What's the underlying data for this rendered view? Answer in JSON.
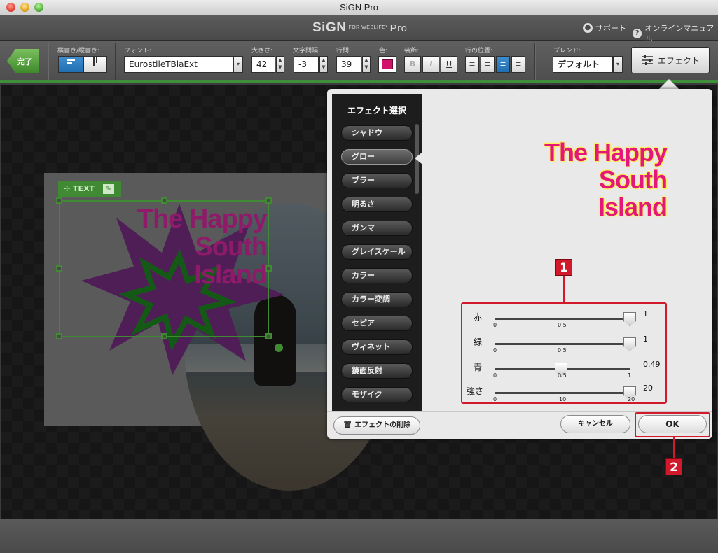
{
  "window": {
    "title": "SiGN Pro"
  },
  "app": {
    "logo_main": "SiGN",
    "logo_sub": "FOR WEBLIFE*",
    "logo_pro": "Pro",
    "support_label": "サポート",
    "manual_label": "オンラインマニュアル"
  },
  "toolbar": {
    "done_label": "完了",
    "orientation_label": "横書き/縦書き:",
    "font_label": "フォント:",
    "font_value": "EurostileTBlaExt",
    "size_label": "大きさ:",
    "size_value": "42",
    "spacing_label": "文字間隔:",
    "spacing_value": "-3",
    "line_label": "行間:",
    "line_value": "39",
    "color_label": "色:",
    "color_value": "#d0106a",
    "decoration_label": "装飾:",
    "deco_bold": "B",
    "deco_italic": "I",
    "deco_underline": "U",
    "align_label": "行の位置:",
    "blend_label": "ブレンド:",
    "blend_value": "デフォルト",
    "effect_button_label": "エフェクト"
  },
  "canvas": {
    "text_tag_label": "TEXT",
    "title_line1": "The Happy",
    "title_line2": "South",
    "title_line3": "Island"
  },
  "effects_panel": {
    "list_title": "エフェクト選択",
    "items": [
      "シャドウ",
      "グロー",
      "ブラー",
      "明るさ",
      "ガンマ",
      "グレイスケール",
      "カラー",
      "カラー変調",
      "セピア",
      "ヴィネット",
      "鏡面反射",
      "モザイク"
    ],
    "selected_item": "グロー",
    "preview_line1": "The Happy",
    "preview_line2": "South",
    "preview_line3": "Island",
    "preview_text_color": "#e4187a",
    "preview_glow_color": "#fff36a",
    "sliders": [
      {
        "label": "赤",
        "value": "1",
        "min": "0",
        "mid": "0.5",
        "max": "",
        "level": 1.0
      },
      {
        "label": "緑",
        "value": "1",
        "min": "0",
        "mid": "0.5",
        "max": "",
        "level": 1.0
      },
      {
        "label": "青",
        "value": "0.49",
        "min": "0",
        "mid": "0.5",
        "max": "1",
        "level": 0.49
      },
      {
        "label": "強さ",
        "value": "20",
        "min": "0",
        "mid": "10",
        "max": "20",
        "level": 1.0
      }
    ],
    "delete_label": "エフェクトの削除",
    "cancel_label": "キャンセル",
    "ok_label": "OK"
  },
  "annotations": {
    "callout_1": "1",
    "callout_2": "2",
    "highlight_color": "#d2192c"
  }
}
